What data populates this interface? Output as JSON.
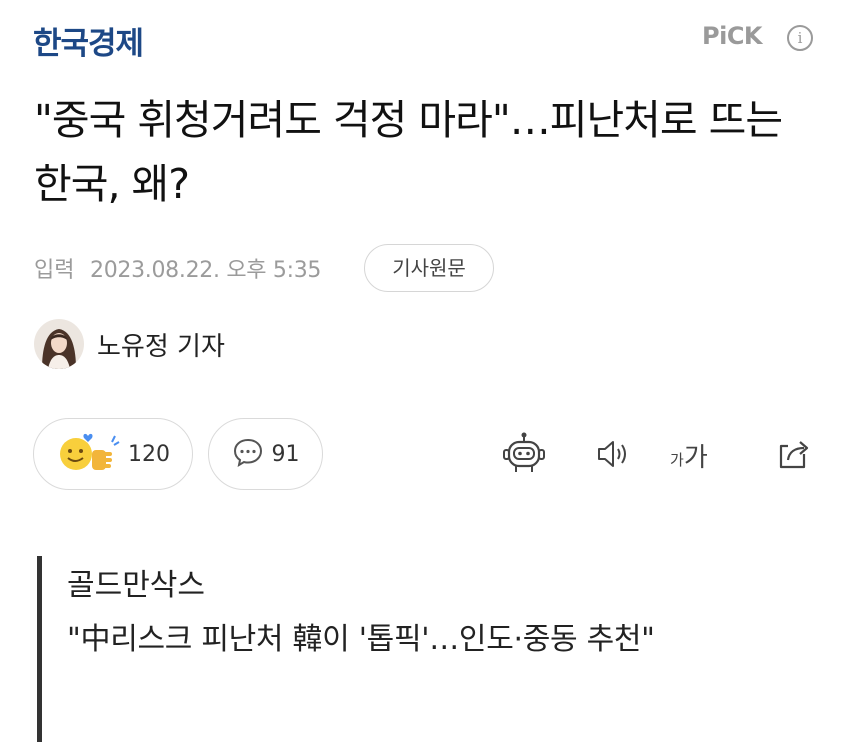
{
  "header": {
    "press_name": "한국경제",
    "pick_label": "PiCK",
    "info_glyph": "i",
    "brand_color": "#1d4886"
  },
  "article": {
    "headline": "\"중국 휘청거려도 걱정 마라\"…피난처로 뜨는 한국, 왜?",
    "date_label": "입력",
    "date_value": "2023.08.22. 오후 5:35",
    "original_link_label": "기사원문",
    "reporter": "노유정 기자"
  },
  "actions": {
    "reaction_count": "120",
    "comment_count": "91",
    "font_small": "가",
    "font_big": "가",
    "icons": [
      "reaction-emoji-icon",
      "comment-bubble-icon",
      "summary-robot-icon",
      "speaker-icon",
      "font-size-icon",
      "share-icon"
    ]
  },
  "quote": {
    "source": "골드만삭스",
    "text": "\"中리스크 피난처 韓이 '톱픽'…인도·중동 추천\""
  }
}
